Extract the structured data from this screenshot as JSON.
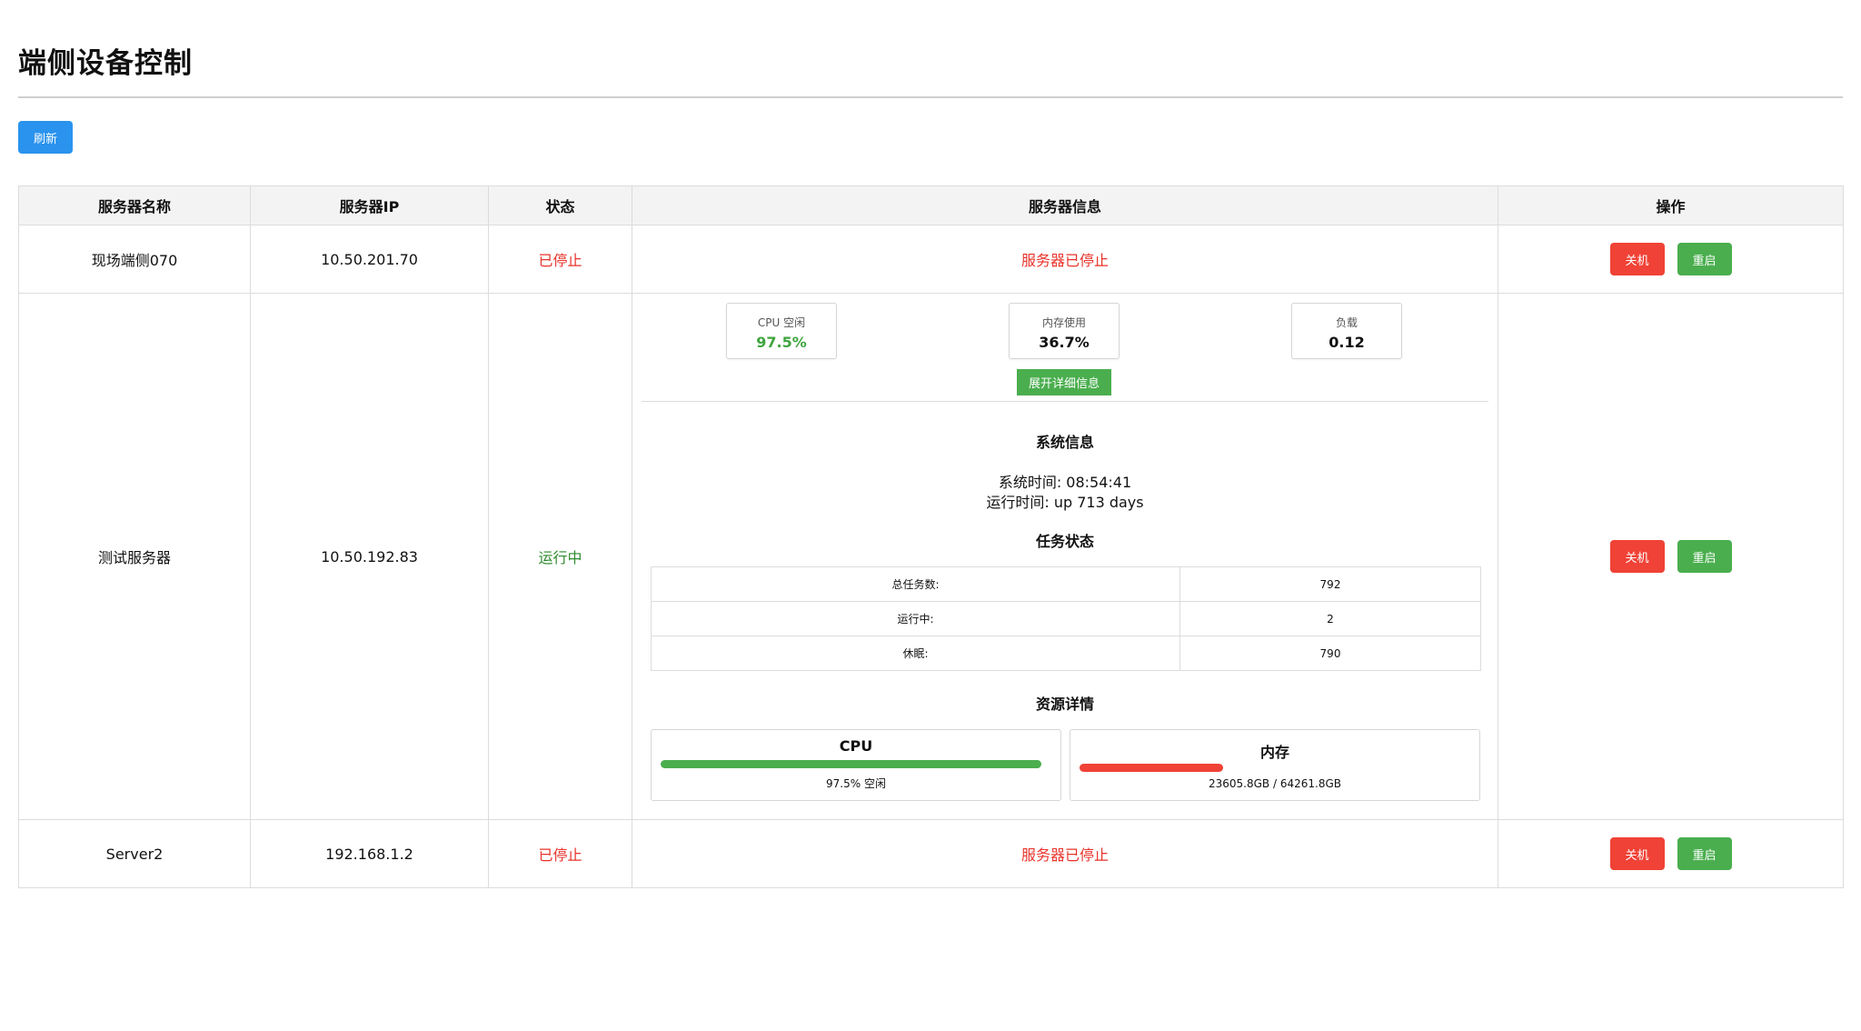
{
  "page": {
    "title": "端侧设备控制",
    "refresh_label": "刷新"
  },
  "table": {
    "headers": [
      "服务器名称",
      "服务器IP",
      "状态",
      "服务器信息",
      "操作"
    ]
  },
  "buttons": {
    "shutdown_label": "关机",
    "reboot_label": "重启",
    "expand_label": "展开详细信息"
  },
  "servers": [
    {
      "name": "现场端侧070",
      "ip": "10.50.201.70",
      "status": "已停止",
      "info": "服务器已停止"
    },
    {
      "name": "测试服务器",
      "ip": "10.50.192.83",
      "status": "运行中",
      "stats": [
        {
          "label": "CPU 空闲",
          "value": "97.5%"
        },
        {
          "label": "内存使用",
          "value": "36.7%"
        },
        {
          "label": "负载",
          "value": "0.12"
        }
      ],
      "system_info_title": "系统信息",
      "system_time": "系统时间: 08:54:41",
      "uptime": "运行时间: up 713 days",
      "task_status_title": "任务状态",
      "tasks": [
        {
          "label": "总任务数:",
          "value": "792"
        },
        {
          "label": "运行中:",
          "value": "2"
        },
        {
          "label": "休眠:",
          "value": "790"
        }
      ],
      "resource_title": "资源详情",
      "cpu": {
        "title": "CPU",
        "fill_fraction": 0.975,
        "text": "97.5% 空闲"
      },
      "memory": {
        "title": "内存",
        "fill_fraction": 0.367,
        "text": "23605.8GB / 64261.8GB"
      }
    },
    {
      "name": "Server2",
      "ip": "192.168.1.2",
      "status": "已停止",
      "info": "服务器已停止"
    }
  ],
  "colors": {
    "refresh": "#2a93ee",
    "shutdown": "#f04236",
    "reboot": "#4aae4e",
    "stopped_text": "#e8332b",
    "running_text": "#2e8b2e"
  }
}
